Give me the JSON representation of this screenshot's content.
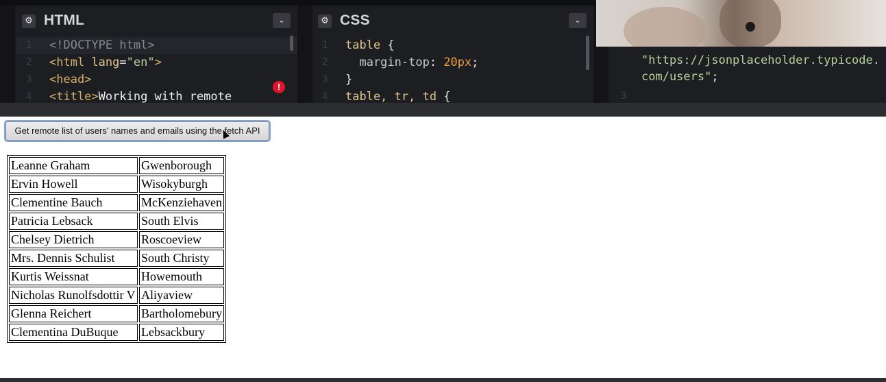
{
  "editors": {
    "html": {
      "title": "HTML",
      "lines": [
        {
          "n": "1",
          "parts": [
            {
              "t": "<!DOCTYPE html>",
              "c": "doctype"
            }
          ]
        },
        {
          "n": "2",
          "parts": [
            {
              "t": "<html ",
              "c": "tag"
            },
            {
              "t": "lang",
              "c": "attr"
            },
            {
              "t": "=",
              "c": "plain"
            },
            {
              "t": "\"en\"",
              "c": "str"
            },
            {
              "t": ">",
              "c": "tag"
            }
          ]
        },
        {
          "n": "3",
          "parts": [
            {
              "t": "<head>",
              "c": "tag"
            }
          ]
        },
        {
          "n": "4",
          "parts": [
            {
              "t": "<title>",
              "c": "tag"
            },
            {
              "t": "Working with remote",
              "c": "wht"
            }
          ]
        }
      ],
      "error_icon": "error-icon"
    },
    "css": {
      "title": "CSS",
      "lines": [
        {
          "n": "1",
          "parts": [
            {
              "t": "table ",
              "c": "sel"
            },
            {
              "t": "{",
              "c": "plain"
            }
          ]
        },
        {
          "n": "2",
          "parts": [
            {
              "t": "  margin-top",
              "c": "prop"
            },
            {
              "t": ": ",
              "c": "plain"
            },
            {
              "t": "20px",
              "c": "num-val"
            },
            {
              "t": ";",
              "c": "plain"
            }
          ]
        },
        {
          "n": "3",
          "parts": [
            {
              "t": "}",
              "c": "plain"
            }
          ]
        },
        {
          "n": "4",
          "parts": [
            {
              "t": "table, tr, td ",
              "c": "sel"
            },
            {
              "t": "{",
              "c": "plain"
            }
          ]
        }
      ]
    },
    "js": {
      "code_line1": "\"https://jsonplaceholder.typicode.",
      "code_line2": "com/users\"",
      "code_line2_semi": ";",
      "line_number": "3"
    }
  },
  "preview": {
    "button_label": "Get remote list of users' names and emails using the fetch API",
    "users": [
      {
        "name": "Leanne Graham",
        "city": "Gwenborough"
      },
      {
        "name": "Ervin Howell",
        "city": "Wisokyburgh"
      },
      {
        "name": "Clementine Bauch",
        "city": "McKenziehaven"
      },
      {
        "name": "Patricia Lebsack",
        "city": "South Elvis"
      },
      {
        "name": "Chelsey Dietrich",
        "city": "Roscoeview"
      },
      {
        "name": "Mrs. Dennis Schulist",
        "city": "South Christy"
      },
      {
        "name": "Kurtis Weissnat",
        "city": "Howemouth"
      },
      {
        "name": "Nicholas Runolfsdottir V",
        "city": "Aliyaview"
      },
      {
        "name": "Glenna Reichert",
        "city": "Bartholomebury"
      },
      {
        "name": "Clementina DuBuque",
        "city": "Lebsackbury"
      }
    ]
  },
  "icons": {
    "gear": "⚙",
    "chevron": "⌄",
    "error": "!"
  },
  "colors": {
    "editor_bg": "#1d1e22",
    "error": "#e0142b",
    "focus_ring": "#7fa6e0"
  }
}
